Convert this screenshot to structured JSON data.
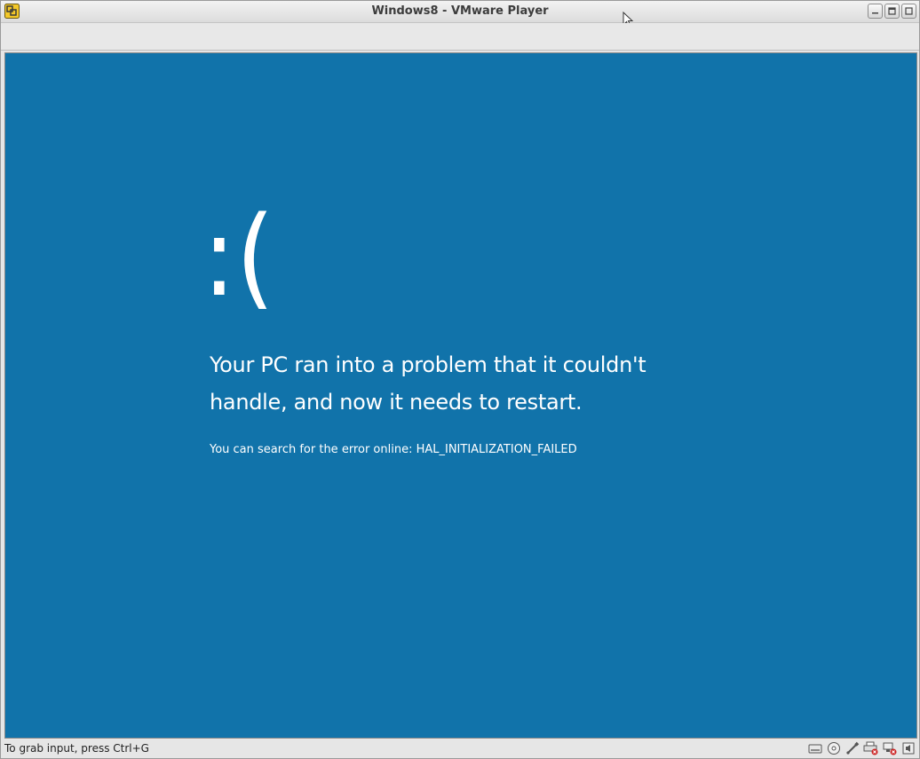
{
  "window": {
    "title": "Windows8 - VMware Player",
    "app_icon": "vmware-player-icon",
    "controls": [
      "minimize-icon",
      "restore-icon",
      "close-icon"
    ]
  },
  "bsod": {
    "background_color": "#1173aa",
    "sad_face": ":(",
    "message": "Your PC ran into a problem that it couldn't handle, and now it needs to restart.",
    "error_line": "You can search for the error online: HAL_INITIALIZATION_FAILED"
  },
  "statusbar": {
    "hint": "To grab input, press Ctrl+G",
    "device_icons": [
      "hard-disk-icon",
      "cd-rom-icon",
      "usb-icon",
      "printer-disconnected-icon",
      "network-disconnected-icon",
      "sound-icon"
    ]
  }
}
